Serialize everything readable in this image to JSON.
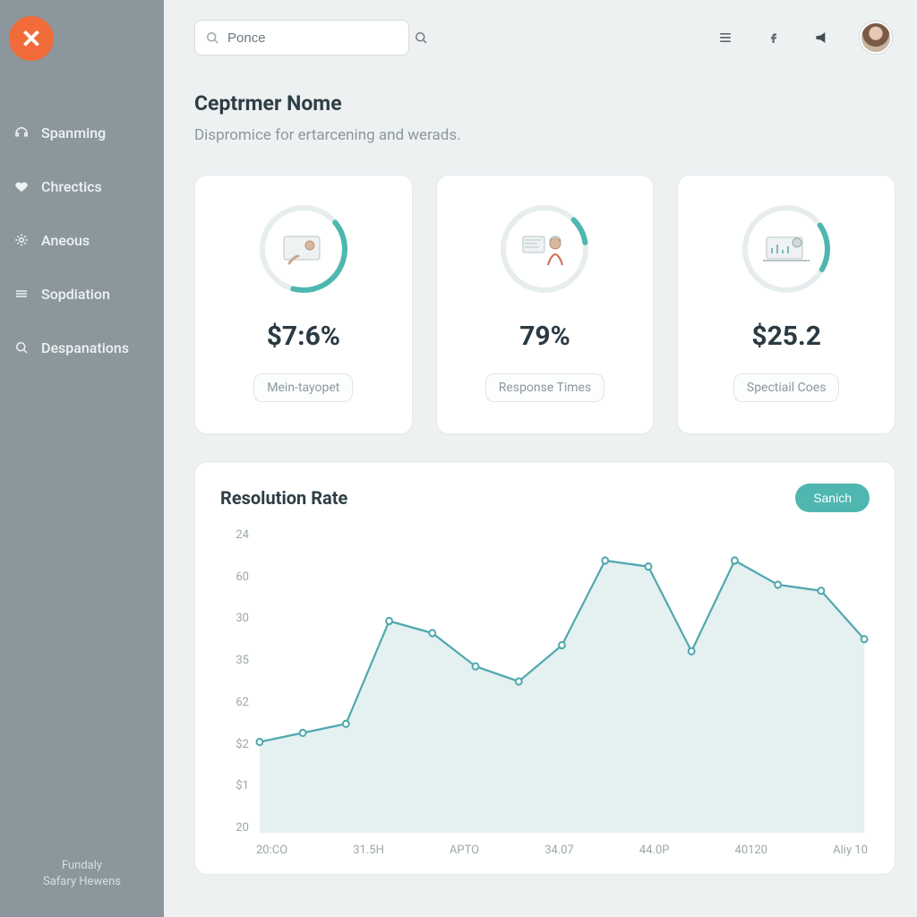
{
  "brand": {
    "logo_glyph": "✕"
  },
  "sidebar": {
    "items": [
      {
        "label": "Spanming",
        "icon": "headset-icon"
      },
      {
        "label": "Chrectics",
        "icon": "heart-icon"
      },
      {
        "label": "Aneous",
        "icon": "sparkle-icon"
      },
      {
        "label": "Sopdiation",
        "icon": "bars-icon"
      },
      {
        "label": "Despanations",
        "icon": "search-icon"
      }
    ],
    "footer_line1": "Fundaly",
    "footer_line2": "Safary Hewens"
  },
  "search": {
    "value": "Ponce",
    "placeholder": "Search"
  },
  "header": {
    "menu_icon": "menu-icon",
    "share_icon": "facebook-icon",
    "sound_icon": "megaphone-icon"
  },
  "page": {
    "title": "Ceptrmer Nome",
    "subtitle": "Dispromice for ertarcening and werads."
  },
  "cards": [
    {
      "value": "$7:6%",
      "label": "Mein-tayopet",
      "ring_pct": 0.4
    },
    {
      "value": "79%",
      "label": "Response Times",
      "ring_pct": 0.1
    },
    {
      "value": "$25.2",
      "label": "Spectiail Coes",
      "ring_pct": 0.18
    }
  ],
  "chart_panel": {
    "title": "Resolution Rate",
    "button": "Sanich"
  },
  "chart_data": {
    "type": "area",
    "title": "Resolution Rate",
    "xlabel": "",
    "ylabel": "",
    "y_ticks": [
      "24",
      "60",
      "30",
      "35",
      "62",
      "$2",
      "$1",
      "20"
    ],
    "categories": [
      "20:CO",
      "31.5H",
      "APTO",
      "34.07",
      "44.0P",
      "40120",
      "Aliy 10"
    ],
    "series": [
      {
        "name": "Resolution Rate",
        "color": "#4fa8ad",
        "values_norm": [
          0.3,
          0.33,
          0.36,
          0.7,
          0.66,
          0.55,
          0.5,
          0.62,
          0.9,
          0.88,
          0.6,
          0.9,
          0.82,
          0.8,
          0.64
        ]
      }
    ]
  },
  "colors": {
    "accent": "#4fb7b0",
    "brand": "#f26b3a",
    "text": "#2b3a42",
    "muted": "#8a989d"
  }
}
